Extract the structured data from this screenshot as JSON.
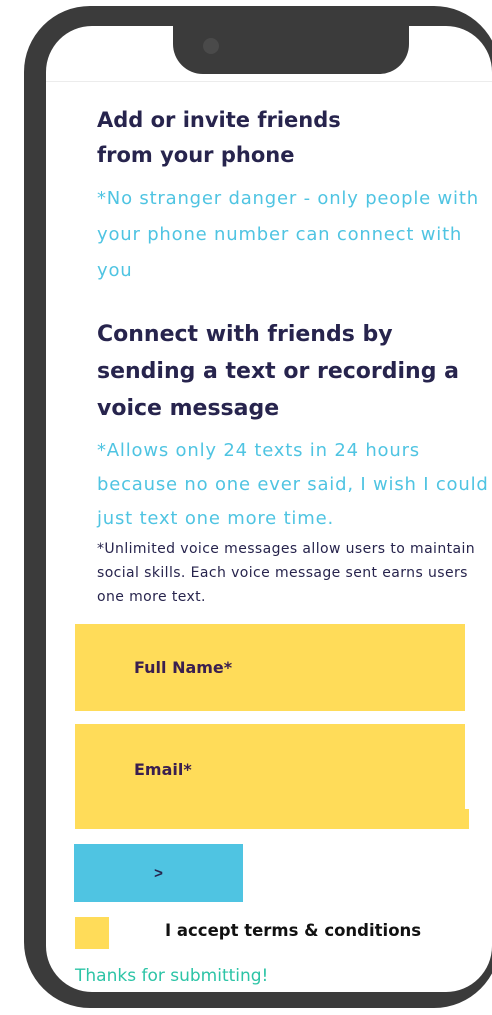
{
  "section1": {
    "title": "Add or invite friends from your phone",
    "note": "*No stranger danger - only people with  your phone number can connect with you"
  },
  "section2": {
    "title": "Connect with  friends by sending  a text or recording a voice message",
    "note": "*Allows only 24 texts in 24 hours because no one ever said, I wish I could just text one more time.",
    "fine_print": "*Unlimited voice messages allow users to maintain social skills. Each voice message sent earns users one more text."
  },
  "form": {
    "full_name_label": "Full Name*",
    "email_label": "Email*",
    "submit_label": ">",
    "terms_label": "I accept terms & conditions",
    "thanks_message": "Thanks for submitting!"
  },
  "colors": {
    "phone_frame": "#3b3b3b",
    "heading": "#27244d",
    "accent_blue": "#4fc4e2",
    "field_yellow": "#ffdc59",
    "success_green": "#2cc4a6"
  }
}
